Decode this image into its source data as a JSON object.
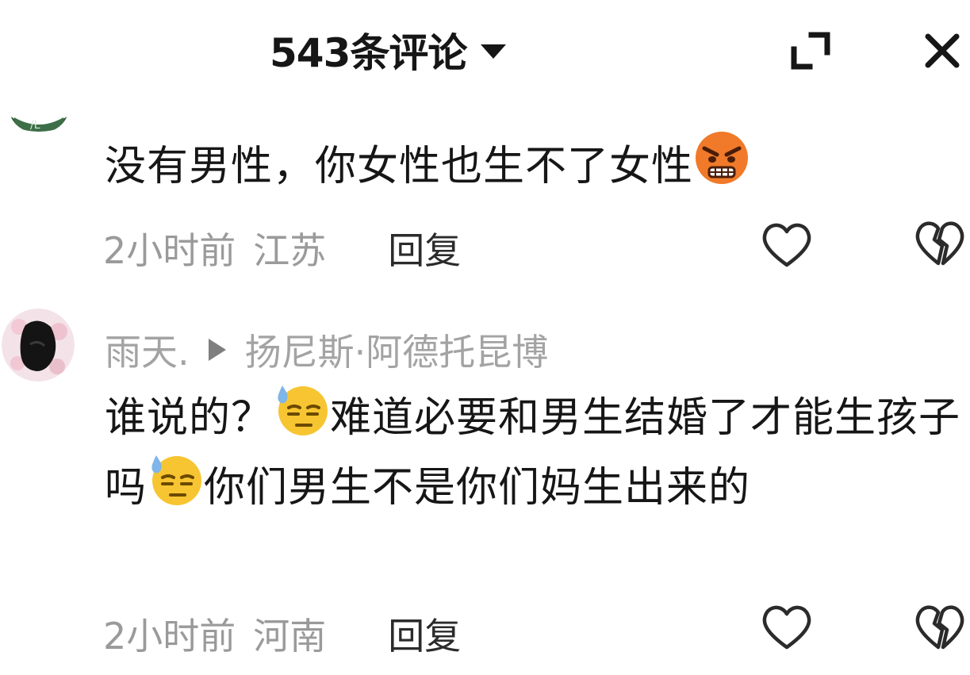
{
  "header": {
    "title": "543条评论"
  },
  "comments": [
    {
      "text": "没有男性，你女性也生不了女性",
      "emoji_after": "angry-face-emoji",
      "time": "2小时前",
      "location": "江苏",
      "reply_label": "回复"
    },
    {
      "username": "雨天.",
      "reply_to": "扬尼斯·阿德托昆博",
      "segments": [
        "谁说的？",
        "难道必要和男生结婚了才能生孩子吗",
        "你们男生不是你们妈生出来的"
      ],
      "emoji": "sweat-face-emoji",
      "time": "2小时前",
      "location": "河南",
      "reply_label": "回复"
    }
  ],
  "icons": {
    "expand": "expand-icon",
    "close": "close-icon",
    "like": "heart-outline-icon",
    "dislike": "broken-heart-icon"
  },
  "colors": {
    "text": "#161616",
    "meta": "#9a9a9a",
    "emoji_angry": "#f07a2a",
    "emoji_sweat": "#f7c531",
    "sweat_drop": "#7fb5e8"
  }
}
